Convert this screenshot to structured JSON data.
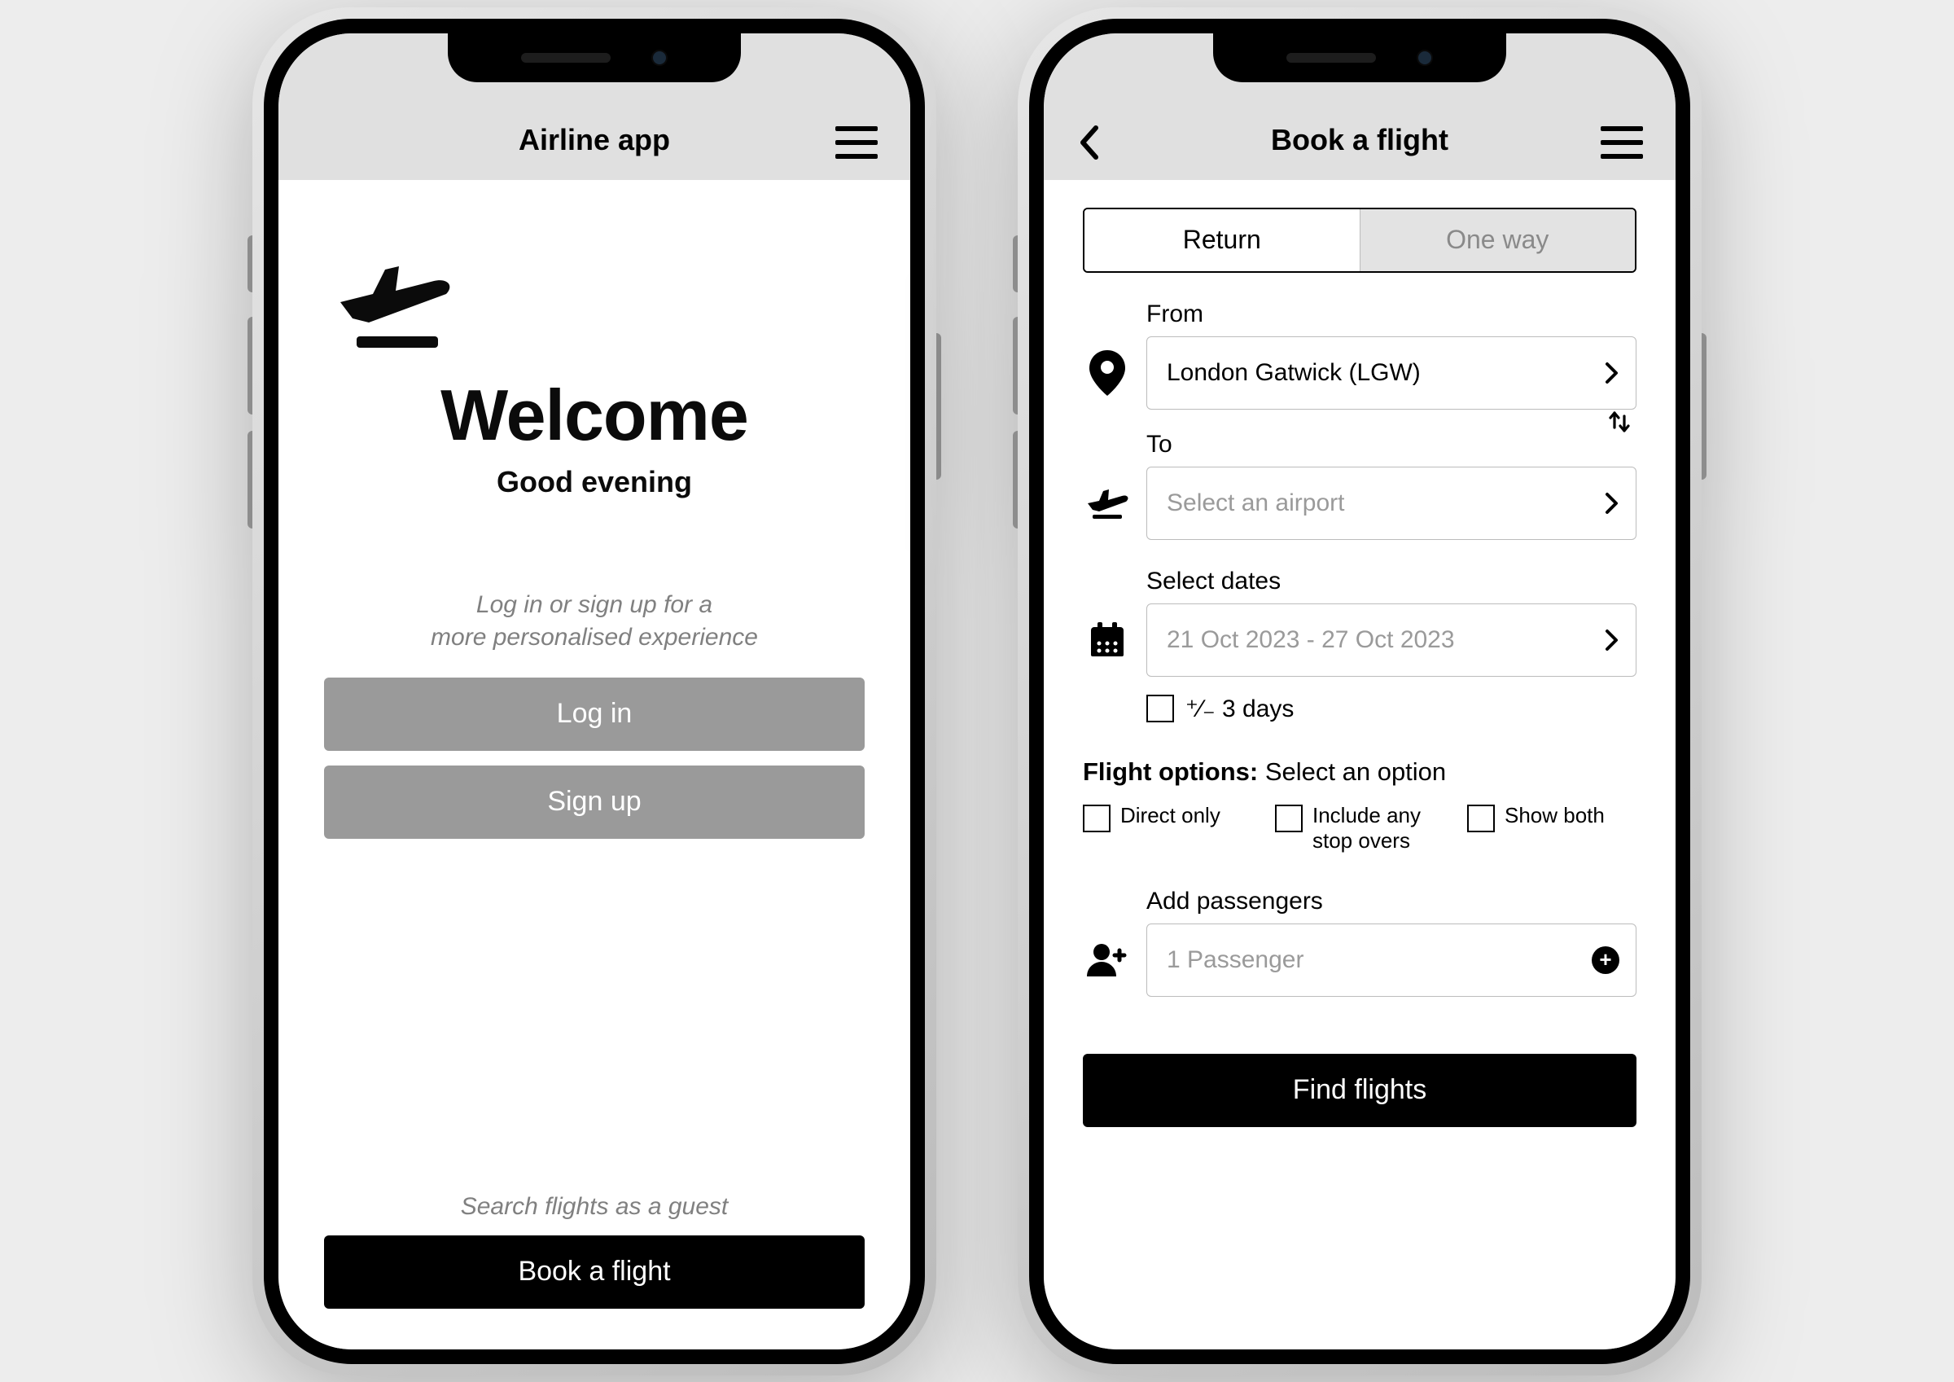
{
  "screen1": {
    "header_title": "Airline app",
    "welcome": "Welcome",
    "subtitle": "Good evening",
    "prompt_line1": "Log in or sign up for a",
    "prompt_line2": "more personalised experience",
    "login_label": "Log in",
    "signup_label": "Sign up",
    "guest_prompt": "Search flights as a guest",
    "book_label": "Book a flight"
  },
  "screen2": {
    "header_title": "Book a flight",
    "tab_return": "Return",
    "tab_oneway": "One way",
    "from_label": "From",
    "from_value": "London Gatwick (LGW)",
    "to_label": "To",
    "to_placeholder": "Select an airport",
    "dates_label": "Select dates",
    "dates_placeholder": "21 Oct 2023 - 27 Oct 2023",
    "plusminus_label": "⁺∕₋ 3 days",
    "options_heading_bold": "Flight options:",
    "options_heading_rest": " Select an option",
    "opt_direct": "Direct only",
    "opt_stopovers": "Include any stop overs",
    "opt_both": "Show both",
    "passengers_label": "Add passengers",
    "passengers_placeholder": "1 Passenger",
    "find_label": "Find flights"
  }
}
